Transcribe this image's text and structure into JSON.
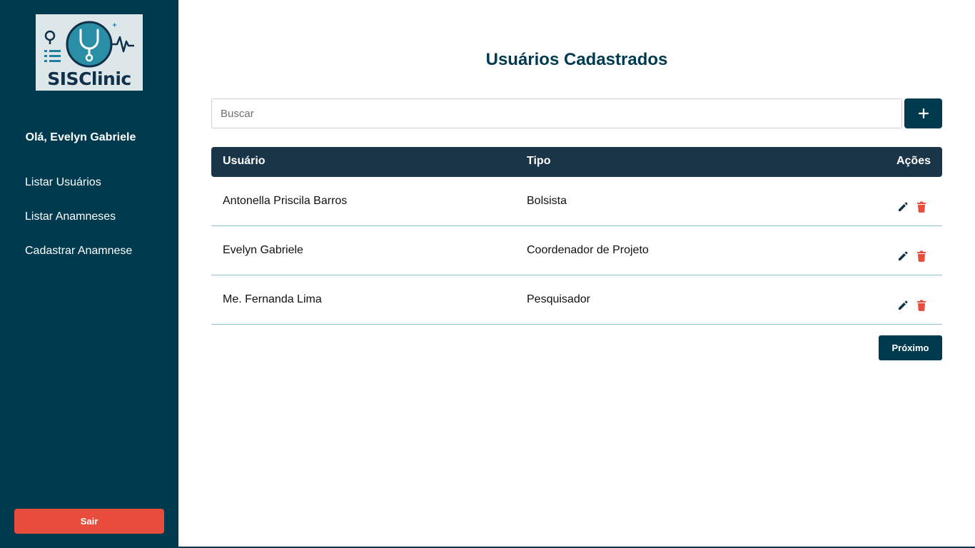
{
  "sidebar": {
    "logo_text": "SISClinic",
    "greeting": "Olá, Evelyn Gabriele",
    "items": [
      {
        "label": "Listar Usuários"
      },
      {
        "label": "Listar Anamneses"
      },
      {
        "label": "Cadastrar Anamnese"
      }
    ],
    "logout_label": "Sair"
  },
  "main": {
    "title": "Usuários Cadastrados",
    "search": {
      "placeholder": "Buscar",
      "value": ""
    },
    "add_icon": "plus-icon",
    "table": {
      "headers": {
        "user": "Usuário",
        "type": "Tipo",
        "actions": "Ações"
      },
      "rows": [
        {
          "user": "Antonella Priscila Barros",
          "type": "Bolsista"
        },
        {
          "user": "Evelyn Gabriele",
          "type": "Coordenador de Projeto"
        },
        {
          "user": "Me. Fernanda Lima",
          "type": "Pesquisador"
        }
      ]
    },
    "next_label": "Próximo"
  },
  "colors": {
    "sidebar_bg": "#003a4f",
    "primary": "#003a4f",
    "table_header": "#1a3547",
    "danger": "#e74c3c",
    "row_border": "#8cc3d1"
  }
}
